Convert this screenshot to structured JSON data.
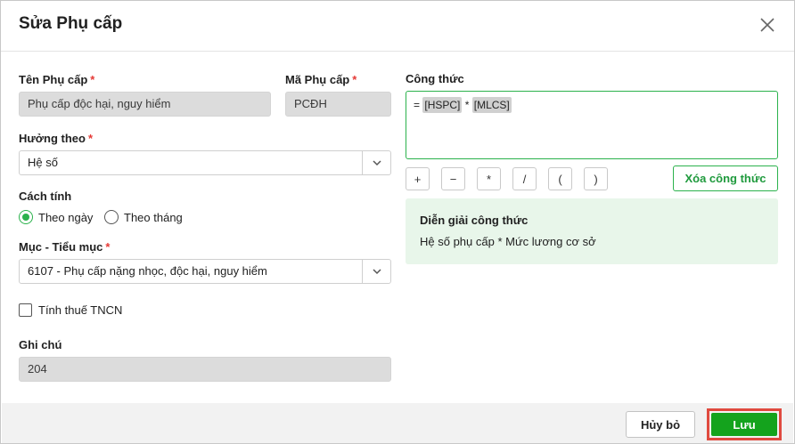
{
  "dialog": {
    "title": "Sửa Phụ cấp"
  },
  "fields": {
    "allowance_name": {
      "label": "Tên Phụ cấp",
      "required_mark": "*",
      "value": "Phụ cấp độc hại, nguy hiểm"
    },
    "allowance_code": {
      "label": "Mã Phụ cấp",
      "required_mark": "*",
      "value": "PCĐH"
    },
    "based_on": {
      "label": "Hưởng theo",
      "required_mark": "*",
      "value": "Hệ số"
    },
    "calc_method": {
      "label": "Cách tính",
      "options": [
        "Theo ngày",
        "Theo tháng"
      ],
      "selected": "Theo ngày"
    },
    "budget_item": {
      "label": "Mục - Tiểu mục",
      "required_mark": "*",
      "value": "6107 - Phụ cấp nặng nhọc, độc hại, nguy hiểm"
    },
    "pit": {
      "label": "Tính thuế TNCN",
      "checked": false
    },
    "note": {
      "label": "Ghi chú",
      "value": "204"
    }
  },
  "formula": {
    "label": "Công thức",
    "prefix": "=",
    "token1": "[HSPC]",
    "operator": "*",
    "token2": "[MLCS]",
    "operators": [
      "+",
      "−",
      "*",
      "/",
      "(",
      ")"
    ],
    "clear_label": "Xóa công thức",
    "explain_title": "Diễn giải công thức",
    "explain_text": "Hệ số phụ cấp * Mức lương cơ sở"
  },
  "footer": {
    "cancel_label": "Hủy bỏ",
    "save_label": "Lưu"
  },
  "colors": {
    "accent": "#2bb24c",
    "save": "#14a31d",
    "required": "#e53935",
    "explain_bg": "#e8f6ea"
  },
  "icons": {
    "close": "close-icon",
    "dropdown": "chevron-down-icon"
  }
}
